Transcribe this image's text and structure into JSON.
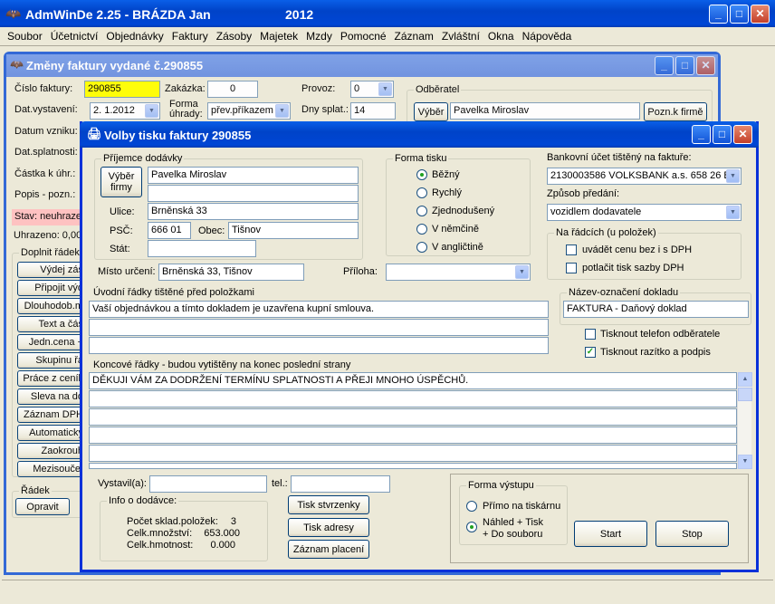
{
  "app": {
    "title": "AdmWinDe 2.25 - BRÁZDA Jan",
    "year": "2012"
  },
  "menu": [
    "Soubor",
    "Účetnictví",
    "Objednávky",
    "Faktury",
    "Zásoby",
    "Majetek",
    "Mzdy",
    "Pomocné",
    "Záznam",
    "Zvláštní",
    "Okna",
    "Nápověda"
  ],
  "invoice": {
    "title": "Změny faktury vydané č.290855",
    "cislo_label": "Číslo faktury:",
    "cislo": "290855",
    "zakazka_label": "Zakázka:",
    "zakazka": "0",
    "provoz_label": "Provoz:",
    "provoz": "0",
    "datvyst_label": "Dat.vystavení:",
    "datvyst": "2. 1.2012",
    "forma_label": "Forma úhrady:",
    "forma": "přev.příkazem",
    "splat_label": "Dny splat.:",
    "splat": "14",
    "odberatel_label": "Odběratel",
    "vyber_label": "Výběr",
    "odberatel": "Pavelka Miroslav",
    "pozn_label": "Pozn.k firmě",
    "datum_vzniku_label": "Datum vzniku:",
    "datsplat_label": "Dat.splatnosti:",
    "castka_label": "Částka k úhr.:",
    "popis_label": "Popis - pozn.:",
    "stav": "Stav: neuhraze",
    "uhrazeno": "Uhrazeno: 0,00",
    "doplnit_label": "Doplnit řádek",
    "side_buttons": [
      "Výdej zás",
      "Připojit výd",
      "Dlouhodob.m",
      "Text a čás",
      "Jedn.cena +",
      "Skupinu řá",
      "Práce z ceník",
      "Sleva na do",
      "Záznam DPH",
      "Automatický",
      "Zaokrouh",
      "Mezisoučet"
    ],
    "radek_label": "Řádek",
    "opravit_label": "Opravit"
  },
  "print": {
    "title": "Volby tisku faktury 290855",
    "prijemce_label": "Příjemce dodávky",
    "vyber_firmy_label": "Výběr firmy",
    "name1": "Pavelka Miroslav",
    "name2": "",
    "ulice_label": "Ulice:",
    "ulice": "Brněnská 33",
    "psc_label": "PSČ:",
    "psc": "666 01",
    "obec_label": "Obec:",
    "obec": "Tišnov",
    "stat_label": "Stát:",
    "stat": "",
    "misto_label": "Místo určení:",
    "misto": "Brněnská 33, Tišnov",
    "priloha_label": "Příloha:",
    "priloha": "",
    "forma_tisku_label": "Forma tisku",
    "forma_tisku": [
      "Běžný",
      "Rychlý",
      "Zjednodušený",
      "V němčině",
      "V angličtině"
    ],
    "banka_label": "Bankovní účet tištěný na faktuře:",
    "banka": "2130003586 VOLKSBANK a.s. 658 26 B",
    "predani_label": "Způsob předání:",
    "predani": "vozidlem dodavatele",
    "naradcich_label": "Na řádcích (u položek)",
    "chk_cena": "uvádět cenu bez i s DPH",
    "chk_sazba": "potlačit tisk sazby DPH",
    "uvodni_label": "Úvodní řádky tištěné před položkami",
    "uvodni": [
      "Vaší objednávkou a tímto dokladem je uzavřena kupní smlouva.",
      "",
      ""
    ],
    "nazev_label": "Název-označení dokladu",
    "nazev": "FAKTURA - Daňový doklad",
    "chk_telefon": "Tisknout telefon odběratele",
    "chk_razitko": "Tisknout razítko a podpis",
    "koncove_label": "Koncové řádky - budou vytištěny na konec poslední strany",
    "koncove": [
      "DĚKUJI VÁM ZA DODRŽENÍ TERMÍNU SPLATNOSTI A PŘEJI MNOHO ÚSPĚCHŮ.",
      "",
      "",
      "",
      "",
      ""
    ],
    "vystavil_label": "Vystavil(a):",
    "vystavil": "",
    "tel_label": "tel.:",
    "tel": "",
    "info_label": "Info o dodávce:",
    "info": [
      {
        "k": "Počet sklad.položek:",
        "v": "3"
      },
      {
        "k": "Celk.množství:",
        "v": "653.000"
      },
      {
        "k": "Celk.hmotnost:",
        "v": "0.000"
      }
    ],
    "tisk_stvrzenky": "Tisk stvrzenky",
    "tisk_adresy": "Tisk adresy",
    "zaznam_placeni": "Záznam placení",
    "forma_vystupu_label": "Forma výstupu",
    "prime": "Přímo na tiskárnu",
    "nahled": "Náhled + Tisk\n+ Do souboru",
    "start": "Start",
    "stop": "Stop"
  }
}
